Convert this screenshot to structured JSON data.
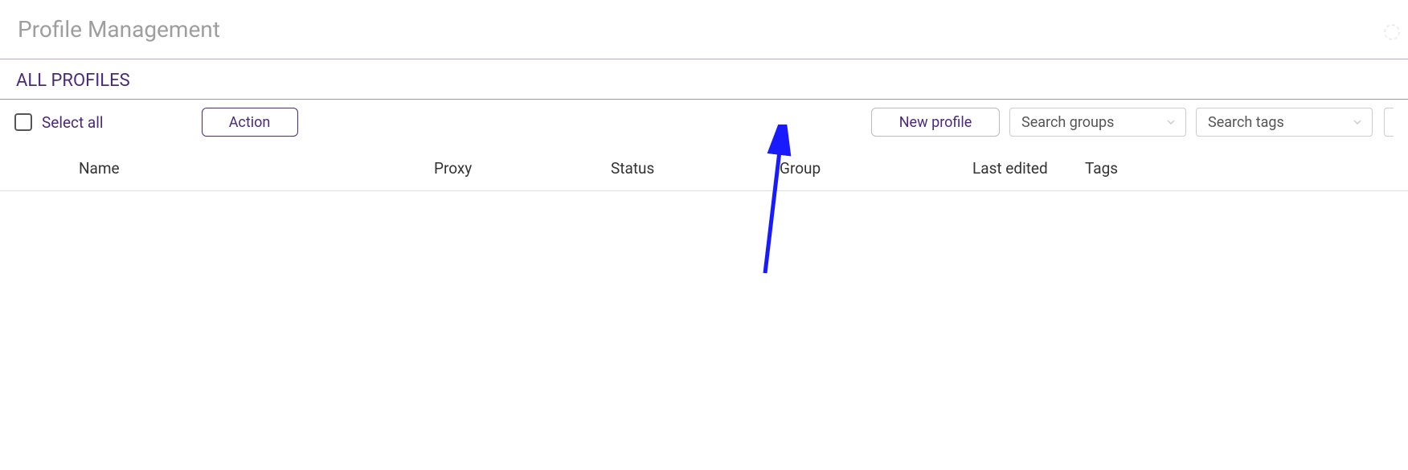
{
  "header": {
    "title": "Profile Management"
  },
  "subtitle": "ALL PROFILES",
  "toolbar": {
    "select_all_label": "Select all",
    "action_label": "Action",
    "new_profile_label": "New profile",
    "search_groups_placeholder": "Search groups",
    "search_tags_placeholder": "Search tags"
  },
  "columns": {
    "name": "Name",
    "proxy": "Proxy",
    "status": "Status",
    "group": "Group",
    "last_edited": "Last edited",
    "tags": "Tags"
  }
}
